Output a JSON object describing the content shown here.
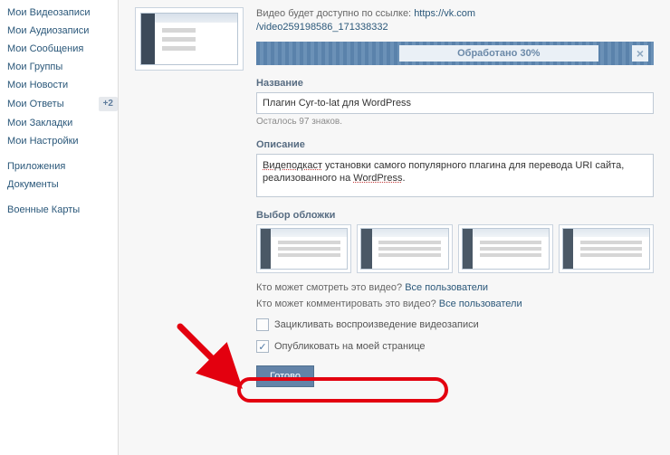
{
  "sidebar": {
    "items": [
      {
        "label": "Мои Видеозаписи"
      },
      {
        "label": "Мои Аудиозаписи"
      },
      {
        "label": "Мои Сообщения"
      },
      {
        "label": "Мои Группы"
      },
      {
        "label": "Мои Новости"
      },
      {
        "label": "Мои Ответы",
        "badge": "+2"
      },
      {
        "label": "Мои Закладки"
      },
      {
        "label": "Мои Настройки"
      }
    ],
    "group2": [
      {
        "label": "Приложения"
      },
      {
        "label": "Документы"
      }
    ],
    "group3": [
      {
        "label": "Военные Карты"
      }
    ]
  },
  "upload": {
    "avail_prefix": "Видео будет доступно по ссылке: ",
    "url_host": "https://vk.com",
    "url_path": "/video259198586_171338332",
    "progress_label": "Обработано 30%"
  },
  "title": {
    "heading": "Название",
    "value": "Плагин Cyr-to-lat для WordPress",
    "hint": "Осталось 97 знаков."
  },
  "description": {
    "heading": "Описание",
    "value": "Видеподкаст установки самого популярного плагина для перевода URI сайта, реализованного на WordPress."
  },
  "covers": {
    "heading": "Выбор обложки"
  },
  "privacy": {
    "view_q": "Кто может смотреть это видео? ",
    "view_a": "Все пользователи",
    "comment_q": "Кто может комментировать это видео? ",
    "comment_a": "Все пользователи",
    "loop_label": "Зацикливать воспроизведение видеозаписи",
    "publish_label": "Опубликовать на моей странице"
  },
  "submit_label": "Готово"
}
